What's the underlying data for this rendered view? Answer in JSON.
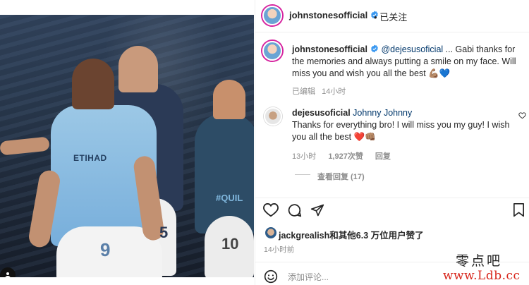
{
  "post": {
    "author": "johnstonesofficial",
    "follow_dot": "•",
    "follow_label": "已关注",
    "caption_mention": "@dejesusoficial",
    "caption_text": " ... Gabi thanks for the memories and always putting a smile on my face. Will miss you and wish you all the best 💪🏽💙",
    "caption_meta_edited": "已编辑",
    "caption_meta_time": "14小时"
  },
  "photo": {
    "sponsor_text": "ETIHAD",
    "number_left": "9",
    "number_mid": "5",
    "number_right": "10",
    "banner_text": "#QUIL"
  },
  "comment": {
    "author": "dejesusoficial",
    "reply_to": "Johnny Johnny",
    "text": "Thanks for everything bro! I will miss you my guy! I wish you all the best ❤️👊🏽",
    "time": "13小时",
    "likes": "1,927次赞",
    "reply_label": "回复",
    "view_replies": "查看回复 (17)"
  },
  "likes_line": "jackgrealish和其他6.3 万位用户赞了",
  "post_time": "14小时前",
  "comment_input": {
    "placeholder": "添加评论..."
  },
  "watermark": {
    "line1": "零点吧",
    "line2": "www.Ldb.cc"
  },
  "icons": {
    "verified": "verified-badge-icon",
    "heart": "heart-icon",
    "comment": "comment-bubble-icon",
    "share": "share-arrow-icon",
    "save": "bookmark-icon",
    "emoji": "emoji-smile-icon",
    "tag": "user-tag-icon"
  },
  "colors": {
    "verified": "#3897f0",
    "mention": "#00376b",
    "muted": "#8e8e8e",
    "watermark_red": "#d8261c"
  }
}
